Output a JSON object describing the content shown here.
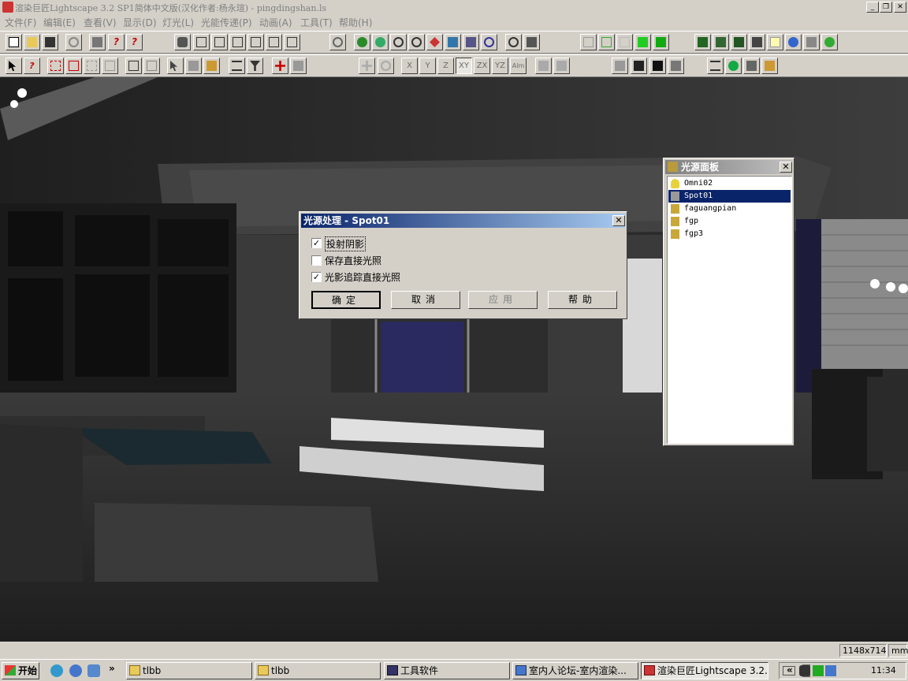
{
  "window": {
    "title": "渲染巨匠Lightscape 3.2 SP1简体中文版(汉化作者:杨永瑄) - pingdingshan.ls",
    "controls": [
      "_",
      "❐",
      "✕"
    ]
  },
  "menu": [
    "文件(F)",
    "编辑(E)",
    "查看(V)",
    "显示(D)",
    "灯光(L)",
    "光能传递(P)",
    "动画(A)",
    "工具(T)",
    "帮助(H)"
  ],
  "toolbar2_axis_labels": [
    "X",
    "Y",
    "Z",
    "XY",
    "ZX",
    "YZ",
    "Alm"
  ],
  "dialog": {
    "title": "光源处理 - Spot01",
    "close": "✕",
    "options": [
      {
        "label": "投射阴影",
        "checked": true
      },
      {
        "label": "保存直接光照",
        "checked": false
      },
      {
        "label": "光影追踪直接光照",
        "checked": true
      }
    ],
    "check_mark": "✓",
    "buttons": {
      "ok": "确定",
      "cancel": "取消",
      "apply": "应用",
      "help": "帮助"
    }
  },
  "light_panel": {
    "title": "光源面板",
    "close": "✕",
    "items": [
      {
        "name": "Omni02",
        "selected": false,
        "icon": "bulb-icon"
      },
      {
        "name": "Spot01",
        "selected": true,
        "icon": "spotlight-icon"
      },
      {
        "name": "faguangpian",
        "selected": false,
        "icon": "light-fixture-icon"
      },
      {
        "name": "fgp",
        "selected": false,
        "icon": "light-fixture-icon"
      },
      {
        "name": "fgp3",
        "selected": false,
        "icon": "light-fixture-icon"
      }
    ]
  },
  "status": {
    "resolution": "1148x714",
    "units": "mm"
  },
  "taskbar": {
    "start": "开始",
    "chevron": "»",
    "tasks": [
      {
        "label": "tlbb",
        "active": false
      },
      {
        "label": "tlbb",
        "active": false
      },
      {
        "label": "工具软件",
        "active": false
      },
      {
        "label": "室内人论坛-室内渲染...",
        "active": false
      },
      {
        "label": "渲染巨匠Lightscape 3.2...",
        "active": true
      }
    ],
    "tray_chevron": "«",
    "clock": "11:34"
  },
  "colors": {
    "title_active": "#0a246a",
    "title_active_end": "#a6caf0",
    "selection": "#0a246a",
    "face": "#d4d0c8"
  }
}
